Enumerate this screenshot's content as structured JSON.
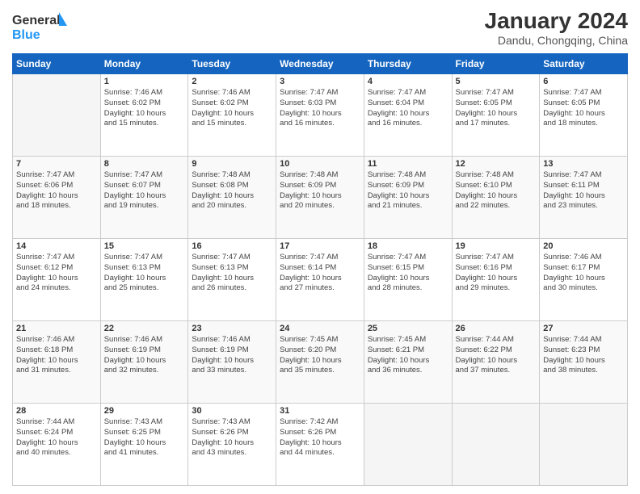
{
  "header": {
    "logo_line1": "General",
    "logo_line2": "Blue",
    "main_title": "January 2024",
    "subtitle": "Dandu, Chongqing, China"
  },
  "days_of_week": [
    "Sunday",
    "Monday",
    "Tuesday",
    "Wednesday",
    "Thursday",
    "Friday",
    "Saturday"
  ],
  "weeks": [
    [
      {
        "day": "",
        "info": ""
      },
      {
        "day": "1",
        "info": "Sunrise: 7:46 AM\nSunset: 6:02 PM\nDaylight: 10 hours\nand 15 minutes."
      },
      {
        "day": "2",
        "info": "Sunrise: 7:46 AM\nSunset: 6:02 PM\nDaylight: 10 hours\nand 15 minutes."
      },
      {
        "day": "3",
        "info": "Sunrise: 7:47 AM\nSunset: 6:03 PM\nDaylight: 10 hours\nand 16 minutes."
      },
      {
        "day": "4",
        "info": "Sunrise: 7:47 AM\nSunset: 6:04 PM\nDaylight: 10 hours\nand 16 minutes."
      },
      {
        "day": "5",
        "info": "Sunrise: 7:47 AM\nSunset: 6:05 PM\nDaylight: 10 hours\nand 17 minutes."
      },
      {
        "day": "6",
        "info": "Sunrise: 7:47 AM\nSunset: 6:05 PM\nDaylight: 10 hours\nand 18 minutes."
      }
    ],
    [
      {
        "day": "7",
        "info": "Sunrise: 7:47 AM\nSunset: 6:06 PM\nDaylight: 10 hours\nand 18 minutes."
      },
      {
        "day": "8",
        "info": "Sunrise: 7:47 AM\nSunset: 6:07 PM\nDaylight: 10 hours\nand 19 minutes."
      },
      {
        "day": "9",
        "info": "Sunrise: 7:48 AM\nSunset: 6:08 PM\nDaylight: 10 hours\nand 20 minutes."
      },
      {
        "day": "10",
        "info": "Sunrise: 7:48 AM\nSunset: 6:09 PM\nDaylight: 10 hours\nand 20 minutes."
      },
      {
        "day": "11",
        "info": "Sunrise: 7:48 AM\nSunset: 6:09 PM\nDaylight: 10 hours\nand 21 minutes."
      },
      {
        "day": "12",
        "info": "Sunrise: 7:48 AM\nSunset: 6:10 PM\nDaylight: 10 hours\nand 22 minutes."
      },
      {
        "day": "13",
        "info": "Sunrise: 7:47 AM\nSunset: 6:11 PM\nDaylight: 10 hours\nand 23 minutes."
      }
    ],
    [
      {
        "day": "14",
        "info": "Sunrise: 7:47 AM\nSunset: 6:12 PM\nDaylight: 10 hours\nand 24 minutes."
      },
      {
        "day": "15",
        "info": "Sunrise: 7:47 AM\nSunset: 6:13 PM\nDaylight: 10 hours\nand 25 minutes."
      },
      {
        "day": "16",
        "info": "Sunrise: 7:47 AM\nSunset: 6:13 PM\nDaylight: 10 hours\nand 26 minutes."
      },
      {
        "day": "17",
        "info": "Sunrise: 7:47 AM\nSunset: 6:14 PM\nDaylight: 10 hours\nand 27 minutes."
      },
      {
        "day": "18",
        "info": "Sunrise: 7:47 AM\nSunset: 6:15 PM\nDaylight: 10 hours\nand 28 minutes."
      },
      {
        "day": "19",
        "info": "Sunrise: 7:47 AM\nSunset: 6:16 PM\nDaylight: 10 hours\nand 29 minutes."
      },
      {
        "day": "20",
        "info": "Sunrise: 7:46 AM\nSunset: 6:17 PM\nDaylight: 10 hours\nand 30 minutes."
      }
    ],
    [
      {
        "day": "21",
        "info": "Sunrise: 7:46 AM\nSunset: 6:18 PM\nDaylight: 10 hours\nand 31 minutes."
      },
      {
        "day": "22",
        "info": "Sunrise: 7:46 AM\nSunset: 6:19 PM\nDaylight: 10 hours\nand 32 minutes."
      },
      {
        "day": "23",
        "info": "Sunrise: 7:46 AM\nSunset: 6:19 PM\nDaylight: 10 hours\nand 33 minutes."
      },
      {
        "day": "24",
        "info": "Sunrise: 7:45 AM\nSunset: 6:20 PM\nDaylight: 10 hours\nand 35 minutes."
      },
      {
        "day": "25",
        "info": "Sunrise: 7:45 AM\nSunset: 6:21 PM\nDaylight: 10 hours\nand 36 minutes."
      },
      {
        "day": "26",
        "info": "Sunrise: 7:44 AM\nSunset: 6:22 PM\nDaylight: 10 hours\nand 37 minutes."
      },
      {
        "day": "27",
        "info": "Sunrise: 7:44 AM\nSunset: 6:23 PM\nDaylight: 10 hours\nand 38 minutes."
      }
    ],
    [
      {
        "day": "28",
        "info": "Sunrise: 7:44 AM\nSunset: 6:24 PM\nDaylight: 10 hours\nand 40 minutes."
      },
      {
        "day": "29",
        "info": "Sunrise: 7:43 AM\nSunset: 6:25 PM\nDaylight: 10 hours\nand 41 minutes."
      },
      {
        "day": "30",
        "info": "Sunrise: 7:43 AM\nSunset: 6:26 PM\nDaylight: 10 hours\nand 43 minutes."
      },
      {
        "day": "31",
        "info": "Sunrise: 7:42 AM\nSunset: 6:26 PM\nDaylight: 10 hours\nand 44 minutes."
      },
      {
        "day": "",
        "info": ""
      },
      {
        "day": "",
        "info": ""
      },
      {
        "day": "",
        "info": ""
      }
    ]
  ]
}
